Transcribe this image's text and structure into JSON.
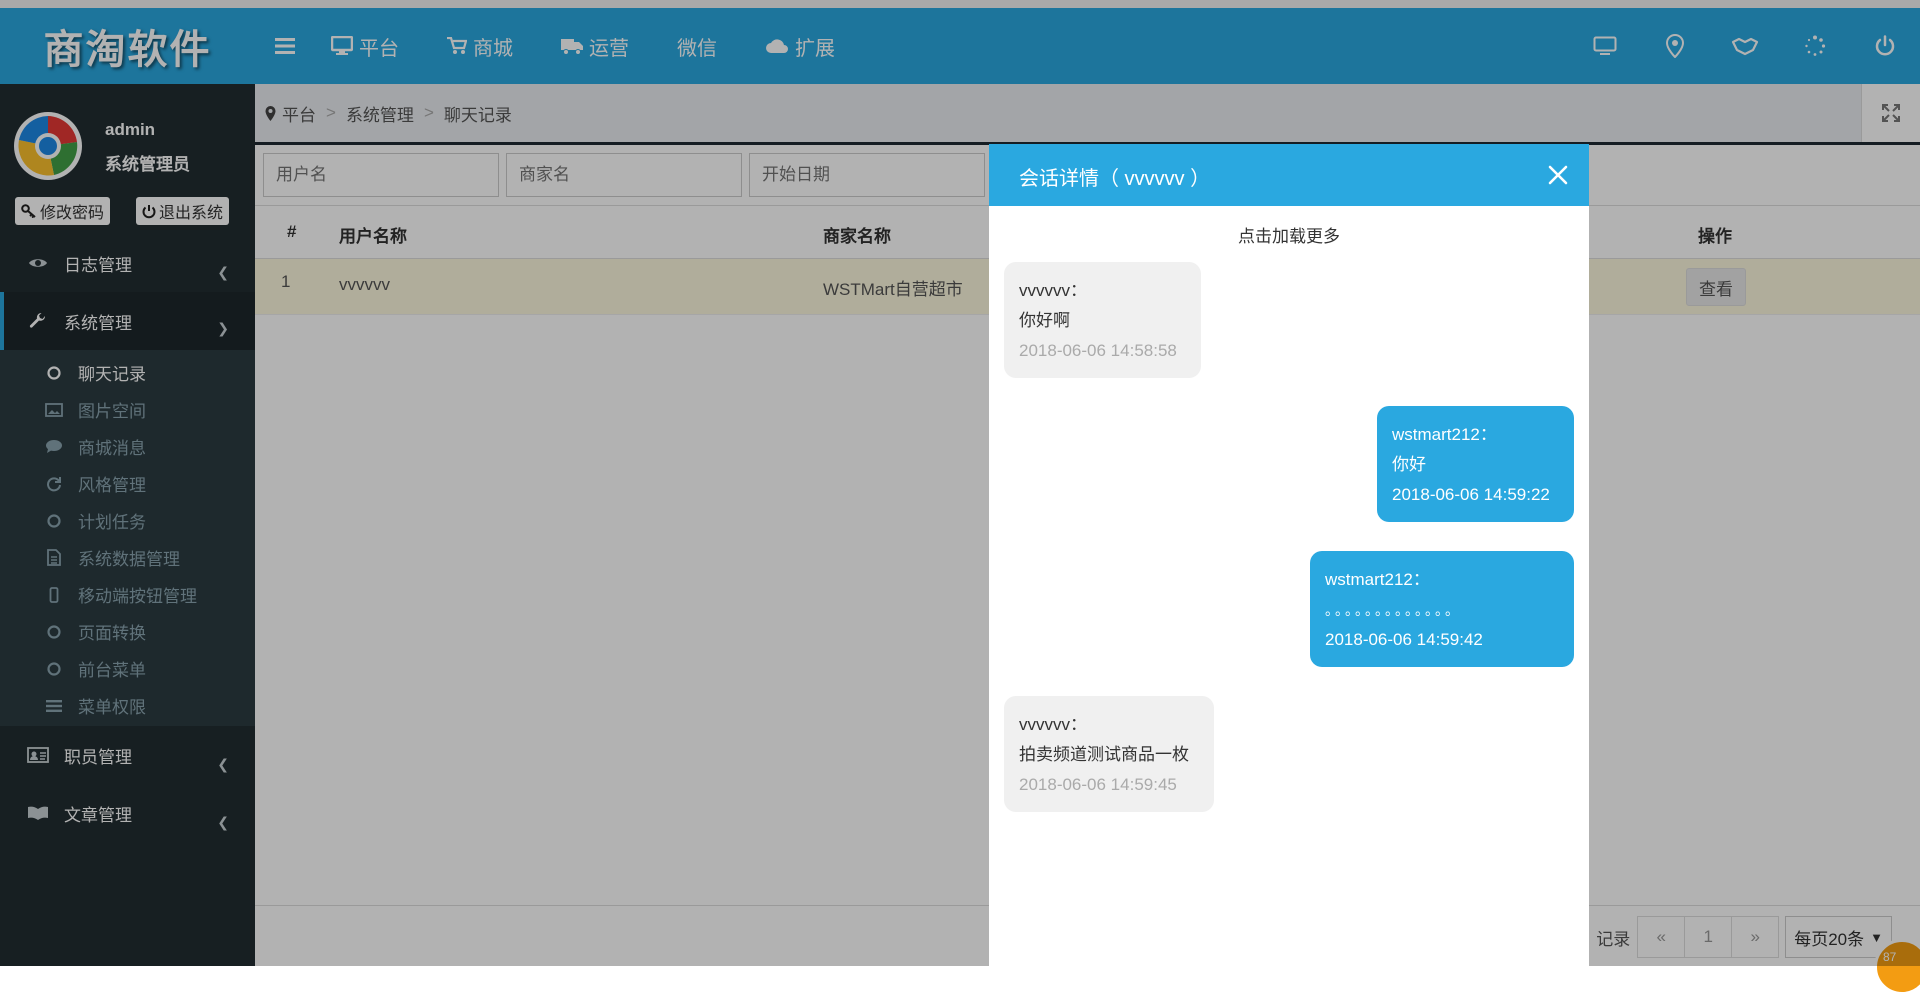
{
  "app": {
    "logo_text": "商淘软件"
  },
  "topnav": {
    "items": [
      {
        "label": "平台",
        "icon": "desktop-icon"
      },
      {
        "label": "商城",
        "icon": "cart-icon"
      },
      {
        "label": "运营",
        "icon": "truck-icon"
      },
      {
        "label": "微信",
        "icon": ""
      },
      {
        "label": "扩展",
        "icon": "cloud-icon"
      }
    ],
    "right_icons": [
      "monitor-icon",
      "map-pin-icon",
      "handshake-icon",
      "loading-icon",
      "power-icon"
    ]
  },
  "sidebar": {
    "username": "admin",
    "role": "系统管理员",
    "change_password": "修改密码",
    "logout": "退出系统",
    "groups": [
      {
        "label": "日志管理",
        "icon": "eye-icon"
      },
      {
        "label": "系统管理",
        "icon": "wrench-icon"
      },
      {
        "label": "职员管理",
        "icon": "id-card-icon"
      },
      {
        "label": "文章管理",
        "icon": "book-icon"
      }
    ],
    "subitems": [
      {
        "label": "聊天记录",
        "icon": "circle-icon"
      },
      {
        "label": "图片空间",
        "icon": "image-icon"
      },
      {
        "label": "商城消息",
        "icon": "comment-icon"
      },
      {
        "label": "风格管理",
        "icon": "refresh-icon"
      },
      {
        "label": "计划任务",
        "icon": "circle-icon"
      },
      {
        "label": "系统数据管理",
        "icon": "file-icon"
      },
      {
        "label": "移动端按钮管理",
        "icon": "mobile-icon"
      },
      {
        "label": "页面转换",
        "icon": "circle-icon"
      },
      {
        "label": "前台菜单",
        "icon": "circle-icon"
      },
      {
        "label": "菜单权限",
        "icon": "list-icon"
      }
    ]
  },
  "breadcrumb": [
    "平台",
    "系统管理",
    "聊天记录"
  ],
  "filters": {
    "username_placeholder": "用户名",
    "shopname_placeholder": "商家名",
    "startdate_placeholder": "开始日期"
  },
  "table": {
    "headers": {
      "index": "#",
      "user": "用户名称",
      "shop": "商家名称",
      "action": "操作"
    },
    "rows": [
      {
        "index": "1",
        "user": "vvvvvv",
        "shop": "WSTMart自营超市",
        "action": "查看"
      }
    ]
  },
  "pagination": {
    "records_suffix": "记录",
    "prev": "«",
    "page": "1",
    "next": "»",
    "page_size": "每页20条",
    "badge": "87"
  },
  "modal": {
    "title": "会话详情（ vvvvvv ）",
    "load_more": "点击加载更多",
    "messages": [
      {
        "side": "left",
        "sender": "vvvvvv：",
        "text": "你好啊",
        "time": "2018-06-06 14:58:58"
      },
      {
        "side": "right",
        "sender": "wstmart212：",
        "text": "你好",
        "time": "2018-06-06 14:59:22"
      },
      {
        "side": "right",
        "sender": "wstmart212：",
        "text": "。。。。。。。。。。。。。",
        "time": "2018-06-06 14:59:42"
      },
      {
        "side": "left",
        "sender": "vvvvvv：",
        "text": "拍卖频道测试商品一枚",
        "time": "2018-06-06 14:59:45"
      }
    ]
  },
  "colors": {
    "primary": "#2aa8e0",
    "sidebar": "#222d32",
    "submenu": "#2c3b41"
  }
}
